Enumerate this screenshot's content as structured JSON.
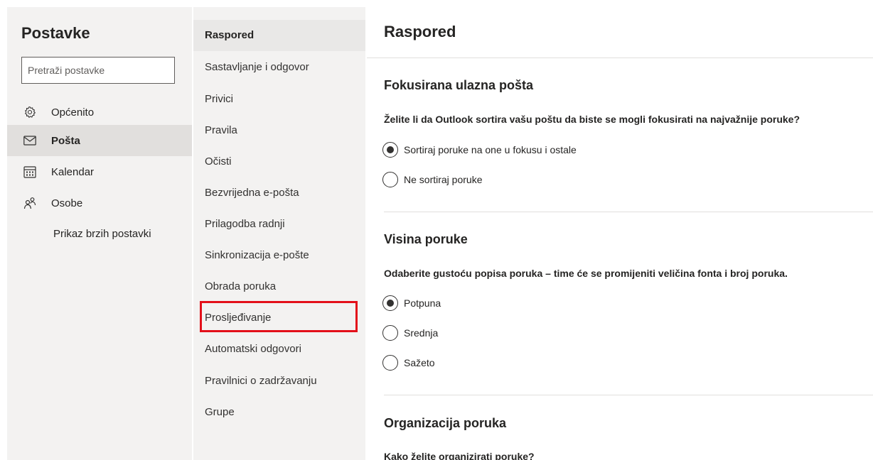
{
  "left": {
    "title": "Postavke",
    "search_placeholder": "Pretraži postavke",
    "nav": [
      {
        "label": "Općenito",
        "icon": "gear-icon"
      },
      {
        "label": "Pošta",
        "icon": "mail-icon"
      },
      {
        "label": "Kalendar",
        "icon": "calendar-icon"
      },
      {
        "label": "Osobe",
        "icon": "people-icon"
      }
    ],
    "active_nav": "Pošta",
    "quick_settings": "Prikaz brzih postavki"
  },
  "middle": {
    "items": [
      "Raspored",
      "Sastavljanje i odgovor",
      "Privici",
      "Pravila",
      "Očisti",
      "Bezvrijedna e-pošta",
      "Prilagodba radnji",
      "Sinkronizacija e-pošte",
      "Obrada poruka",
      "Prosljeđivanje",
      "Automatski odgovori",
      "Pravilnici o zadržavanju",
      "Grupe"
    ],
    "active_item": "Raspored",
    "highlighted_item": "Prosljeđivanje",
    "highlight_color": "#e3101a"
  },
  "right": {
    "title": "Raspored",
    "sections": [
      {
        "title": "Fokusirana ulazna pošta",
        "question": "Želite li da Outlook sortira vašu poštu da biste se mogli fokusirati na najvažnije poruke?",
        "options": [
          {
            "label": "Sortiraj poruke na one u fokusu i ostale",
            "checked": true
          },
          {
            "label": "Ne sortiraj poruke",
            "checked": false
          }
        ]
      },
      {
        "title": "Visina poruke",
        "question": "Odaberite gustoću popisa poruka – time će se promijeniti veličina fonta i broj poruka.",
        "options": [
          {
            "label": "Potpuna",
            "checked": true
          },
          {
            "label": "Srednja",
            "checked": false
          },
          {
            "label": "Sažeto",
            "checked": false
          }
        ]
      },
      {
        "title": "Organizacija poruka",
        "question": "Kako želite organizirati poruke?"
      }
    ]
  }
}
